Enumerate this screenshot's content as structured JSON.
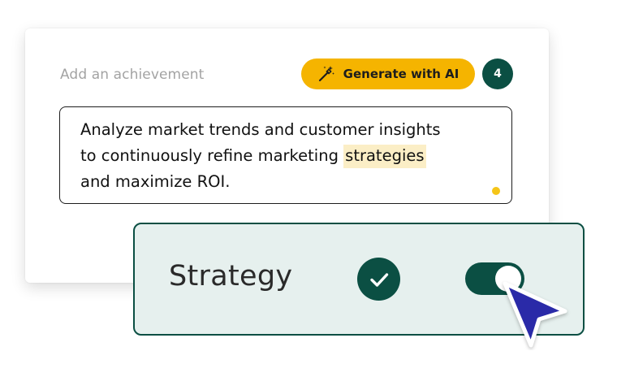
{
  "card": {
    "field_label": "Add an achievement",
    "generate_button": {
      "label": "Generate with AI",
      "icon": "magic-wand-icon",
      "color": "#f5b400"
    },
    "count_badge": "4",
    "achievement_text": {
      "line1": "Analyze market trends and customer insights",
      "line2_before": "to continuously refine marketing ",
      "line2_highlight": "strategies",
      "line3": "and maximize ROI."
    }
  },
  "suggestion": {
    "label": "Strategy",
    "check_icon": "checkmark-icon",
    "toggle_on": true
  },
  "cursor": {
    "icon": "pointer-cursor-icon",
    "color": "#2a2aa8"
  },
  "colors": {
    "primary_green": "#0b4f43",
    "accent_yellow": "#f5b400",
    "highlight": "#fbeec6",
    "suggestion_bg": "#e6f0ee"
  }
}
